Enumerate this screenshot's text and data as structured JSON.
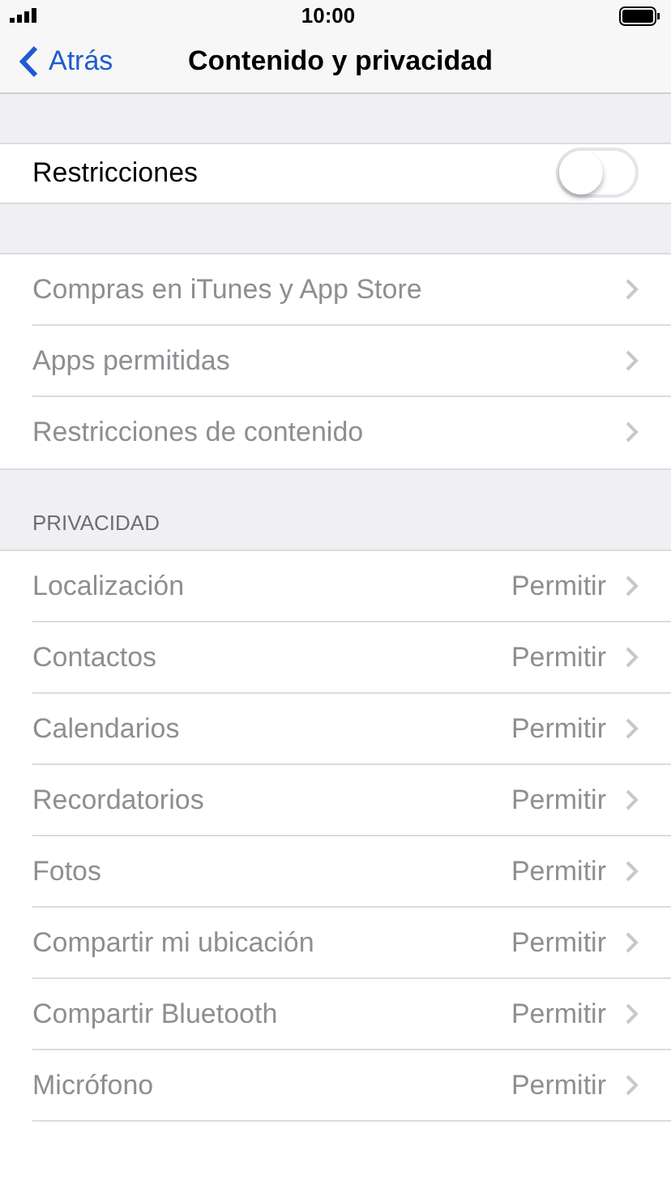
{
  "status_bar": {
    "time": "10:00"
  },
  "nav": {
    "back": "Atrás",
    "title": "Contenido y privacidad"
  },
  "restrictions": {
    "label": "Restricciones",
    "on": false
  },
  "store_items": [
    {
      "label": "Compras en iTunes y App Store",
      "disabled": true
    },
    {
      "label": "Apps permitidas",
      "disabled": true
    },
    {
      "label": "Restricciones de contenido",
      "disabled": true
    }
  ],
  "privacy": {
    "header": "PRIVACIDAD",
    "items": [
      {
        "label": "Localización",
        "value": "Permitir",
        "disabled": true
      },
      {
        "label": "Contactos",
        "value": "Permitir",
        "disabled": true
      },
      {
        "label": "Calendarios",
        "value": "Permitir",
        "disabled": true
      },
      {
        "label": "Recordatorios",
        "value": "Permitir",
        "disabled": true
      },
      {
        "label": "Fotos",
        "value": "Permitir",
        "disabled": true
      },
      {
        "label": "Compartir mi ubicación",
        "value": "Permitir",
        "disabled": true
      },
      {
        "label": "Compartir Bluetooth",
        "value": "Permitir",
        "disabled": true
      },
      {
        "label": "Micrófono",
        "value": "Permitir",
        "disabled": true
      }
    ]
  }
}
